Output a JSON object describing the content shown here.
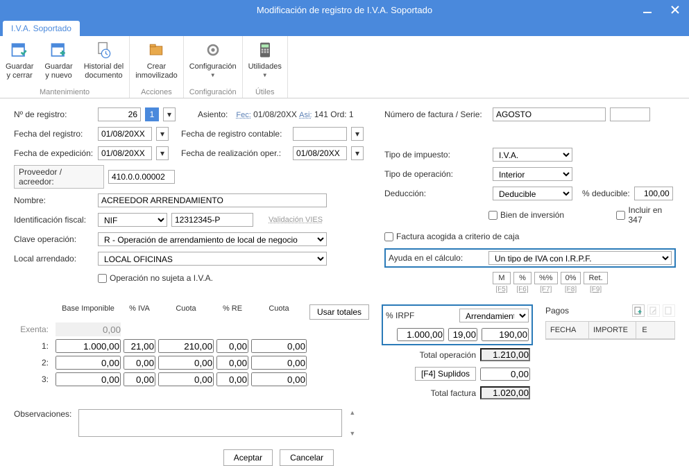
{
  "window": {
    "title": "Modificación de registro de I.V.A. Soportado"
  },
  "ribbon": {
    "tab": "I.V.A. Soportado",
    "groups": {
      "mantenimiento": {
        "label": "Mantenimiento",
        "save_close": "Guardar\ny cerrar",
        "save_new": "Guardar\ny nuevo",
        "history": "Historial del\ndocumento"
      },
      "acciones": {
        "label": "Acciones",
        "crear_inmov": "Crear\ninmovilizado"
      },
      "config": {
        "label": "Configuración",
        "config": "Configuración"
      },
      "utiles": {
        "label": "Útiles",
        "utilidades": "Utilidades"
      }
    }
  },
  "form": {
    "nregistro_label": "Nº de registro:",
    "nregistro": "26",
    "nregistro_sub": "1",
    "asiento_label": "Asiento:",
    "asiento_fec": "Fec:",
    "asiento_fecha": "01/08/20XX",
    "asiento_asi": "Asi:",
    "asiento_asi_v": "141",
    "asiento_ord": "Ord:",
    "asiento_ord_v": "1",
    "fecha_registro_label": "Fecha del registro:",
    "fecha_registro": "01/08/20XX",
    "fecha_contable_label": "Fecha de registro contable:",
    "fecha_exped_label": "Fecha de expedición:",
    "fecha_exped": "01/08/20XX",
    "fecha_oper_label": "Fecha de realización oper.:",
    "fecha_oper": "01/08/20XX",
    "proveedor_label": "Proveedor / acreedor:",
    "proveedor": "410.0.0.00002",
    "nombre_label": "Nombre:",
    "nombre": "ACREEDOR ARRENDAMIENTO",
    "idfiscal_label": "Identificación fiscal:",
    "idtipo": "NIF",
    "idnum": "12312345-P",
    "vies": "Validación VIES",
    "clave_label": "Clave operación:",
    "clave": "R - Operación de arrendamiento de local de negocio",
    "local_label": "Local arrendado:",
    "local": "LOCAL OFICINAS",
    "no_sujeta": "Operación no sujeta a I.V.A.",
    "nfactura_label": "Número de factura / Serie:",
    "nfactura": "AGOSTO",
    "tipo_imp_label": "Tipo de impuesto:",
    "tipo_imp": "I.V.A.",
    "tipo_op_label": "Tipo de operación:",
    "tipo_op": "Interior",
    "deduccion_label": "Deducción:",
    "deduccion": "Deducible",
    "pct_deducible_label": "% deducible:",
    "pct_deducible": "100,00",
    "bien_inv": "Bien de inversión",
    "incluir347": "Incluir en 347",
    "criterio_caja": "Factura acogida a criterio de caja",
    "ayuda_label": "Ayuda en el cálculo:",
    "ayuda": "Un tipo de IVA con I.R.P.F.",
    "keys": {
      "M": "M",
      "pct": "%",
      "pctpct": "%%",
      "zero": "0%",
      "ret": "Ret.",
      "f5": "[F5]",
      "f6": "[F6]",
      "f7": "[F7]",
      "f8": "[F8]",
      "f9": "[F9]"
    }
  },
  "grid": {
    "headers": {
      "base": "Base Imponible",
      "piva": "% IVA",
      "cuota": "Cuota",
      "pre": "% RE",
      "cuotare": "Cuota",
      "usar": "Usar totales"
    },
    "rows": {
      "exenta_label": "Exenta:",
      "exenta_base": "0,00",
      "r1_label": "1:",
      "r1_base": "1.000,00",
      "r1_piva": "21,00",
      "r1_cuota": "210,00",
      "r1_pre": "0,00",
      "r1_cre": "0,00",
      "r2_label": "2:",
      "r2_base": "0,00",
      "r2_piva": "0,00",
      "r2_cuota": "0,00",
      "r2_pre": "0,00",
      "r2_cre": "0,00",
      "r3_label": "3:",
      "r3_base": "0,00",
      "r3_piva": "0,00",
      "r3_cuota": "0,00",
      "r3_pre": "0,00",
      "r3_cre": "0,00"
    },
    "irpf": {
      "pct_label": "% IRPF",
      "tipo": "Arrendamient",
      "base": "1.000,00",
      "pct": "19,00",
      "importe": "190,00"
    },
    "totals": {
      "total_op_label": "Total operación",
      "total_op": "1.210,00",
      "suplidos_label": "[F4] Suplidos",
      "suplidos": "0,00",
      "total_fac_label": "Total factura",
      "total_fac": "1.020,00"
    },
    "pagos": {
      "title": "Pagos",
      "fecha": "FECHA",
      "importe": "IMPORTE",
      "e": "E"
    },
    "observ_label": "Observaciones:"
  },
  "footer": {
    "aceptar": "Aceptar",
    "cancelar": "Cancelar"
  }
}
